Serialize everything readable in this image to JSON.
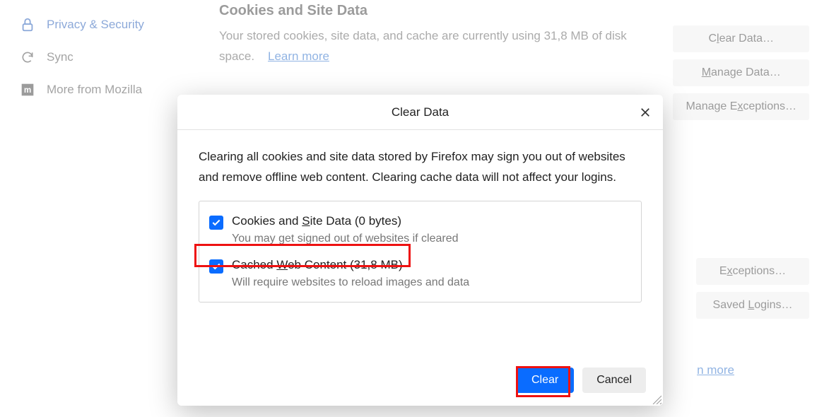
{
  "sidebar": {
    "privacy": "Privacy & Security",
    "sync": "Sync",
    "more": "More from Mozilla"
  },
  "main": {
    "cookies_heading": "Cookies and Site Data",
    "cookies_desc": "Your stored cookies, site data, and cache are currently using 31,8 MB of disk space.",
    "learn_more": "Learn more",
    "learn_more_fragment": "n more"
  },
  "buttons": {
    "clear_data_pre": "C",
    "clear_data_u": "l",
    "clear_data_post": "ear Data…",
    "manage_data_u": "M",
    "manage_data_post": "anage Data…",
    "manage_exc_pre": "Manage E",
    "manage_exc_u": "x",
    "manage_exc_post": "ceptions…",
    "exceptions_pre": "E",
    "exceptions_u": "x",
    "exceptions_post": "ceptions…",
    "saved_logins_pre": "Saved ",
    "saved_logins_u": "L",
    "saved_logins_post": "ogins…"
  },
  "dialog": {
    "title": "Clear Data",
    "desc": "Clearing all cookies and site data stored by Firefox may sign you out of websites and remove offline web content. Clearing cache data will not affect your logins.",
    "opt1_pre": "Cookies and ",
    "opt1_u": "S",
    "opt1_post": "ite Data (0 bytes)",
    "opt1_sub": "You may get signed out of websites if cleared",
    "opt2_pre": "Cached ",
    "opt2_u": "W",
    "opt2_post": "eb Content (31,8 MB)",
    "opt2_sub": "Will require websites to reload images and data",
    "clear_btn": "Clear",
    "cancel_btn": "Cancel"
  }
}
